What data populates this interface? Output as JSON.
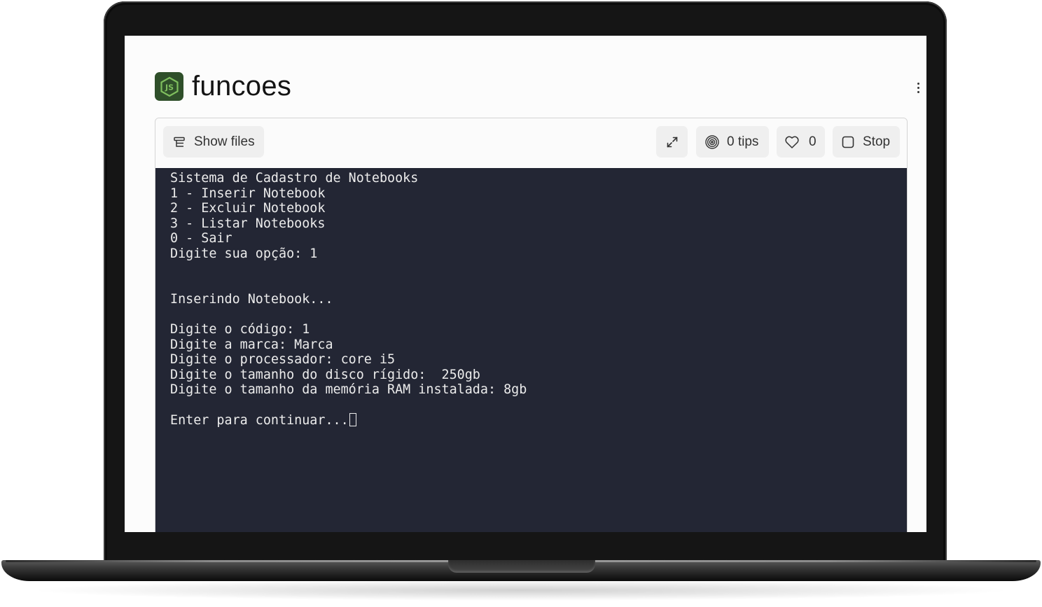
{
  "app": {
    "title": "funcoes",
    "logo_icon": "nodejs-icon"
  },
  "toolbar": {
    "show_files_label": "Show files",
    "tips_label": "0 tips",
    "likes_count": "0",
    "stop_label": "Stop"
  },
  "terminal": {
    "lines": [
      "Sistema de Cadastro de Notebooks",
      "1 - Inserir Notebook",
      "2 - Excluir Notebook",
      "3 - Listar Notebooks",
      "0 - Sair",
      "Digite sua opção: 1",
      "",
      "",
      "Inserindo Notebook...",
      "",
      "Digite o código: 1",
      "Digite a marca: Marca",
      "Digite o processador: core i5",
      "Digite o tamanho do disco rígido:  250gb",
      "Digite o tamanho da memória RAM instalada: 8gb",
      "",
      "Enter para continuar..."
    ]
  },
  "colors": {
    "terminal_bg": "#232634",
    "terminal_fg": "#ececec",
    "button_bg": "#efefef",
    "logo_bg": "#2f4f2a"
  }
}
